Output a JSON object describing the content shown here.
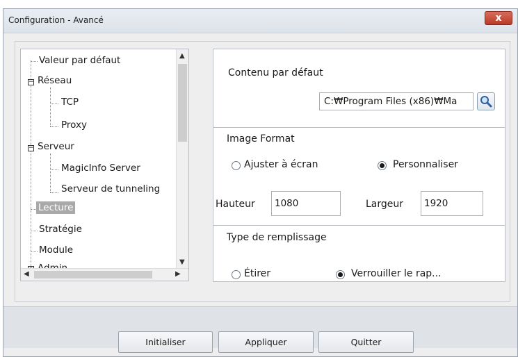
{
  "window": {
    "title": "Configuration - Avancé",
    "close_label": "x"
  },
  "tree": {
    "items": {
      "valeur": "Valeur par défaut",
      "reseau": "Réseau",
      "tcp": "TCP",
      "proxy": "Proxy",
      "serveur": "Serveur",
      "magicinfo": "MagicInfo Server",
      "tunneling": "Serveur de tunneling",
      "lecture": "Lecture",
      "strategie": "Stratégie",
      "module": "Module",
      "admin": "Admin"
    },
    "selected": "Lecture"
  },
  "settings": {
    "default_content_label": "Contenu par défaut",
    "default_content_path": "C:₩Program Files (x86)₩Ma",
    "image_format_label": "Image Format",
    "fit_screen_label": "Ajuster à écran",
    "custom_label": "Personnaliser",
    "height_label": "Hauteur",
    "height_value": "1080",
    "width_label": "Largeur",
    "width_value": "1920",
    "fill_type_label": "Type de remplissage",
    "stretch_label": "Étirer",
    "lock_ratio_label": "Verrouiller le rap..."
  },
  "buttons": {
    "reset": "Initialiser",
    "apply": "Appliquer",
    "quit": "Quitter"
  }
}
